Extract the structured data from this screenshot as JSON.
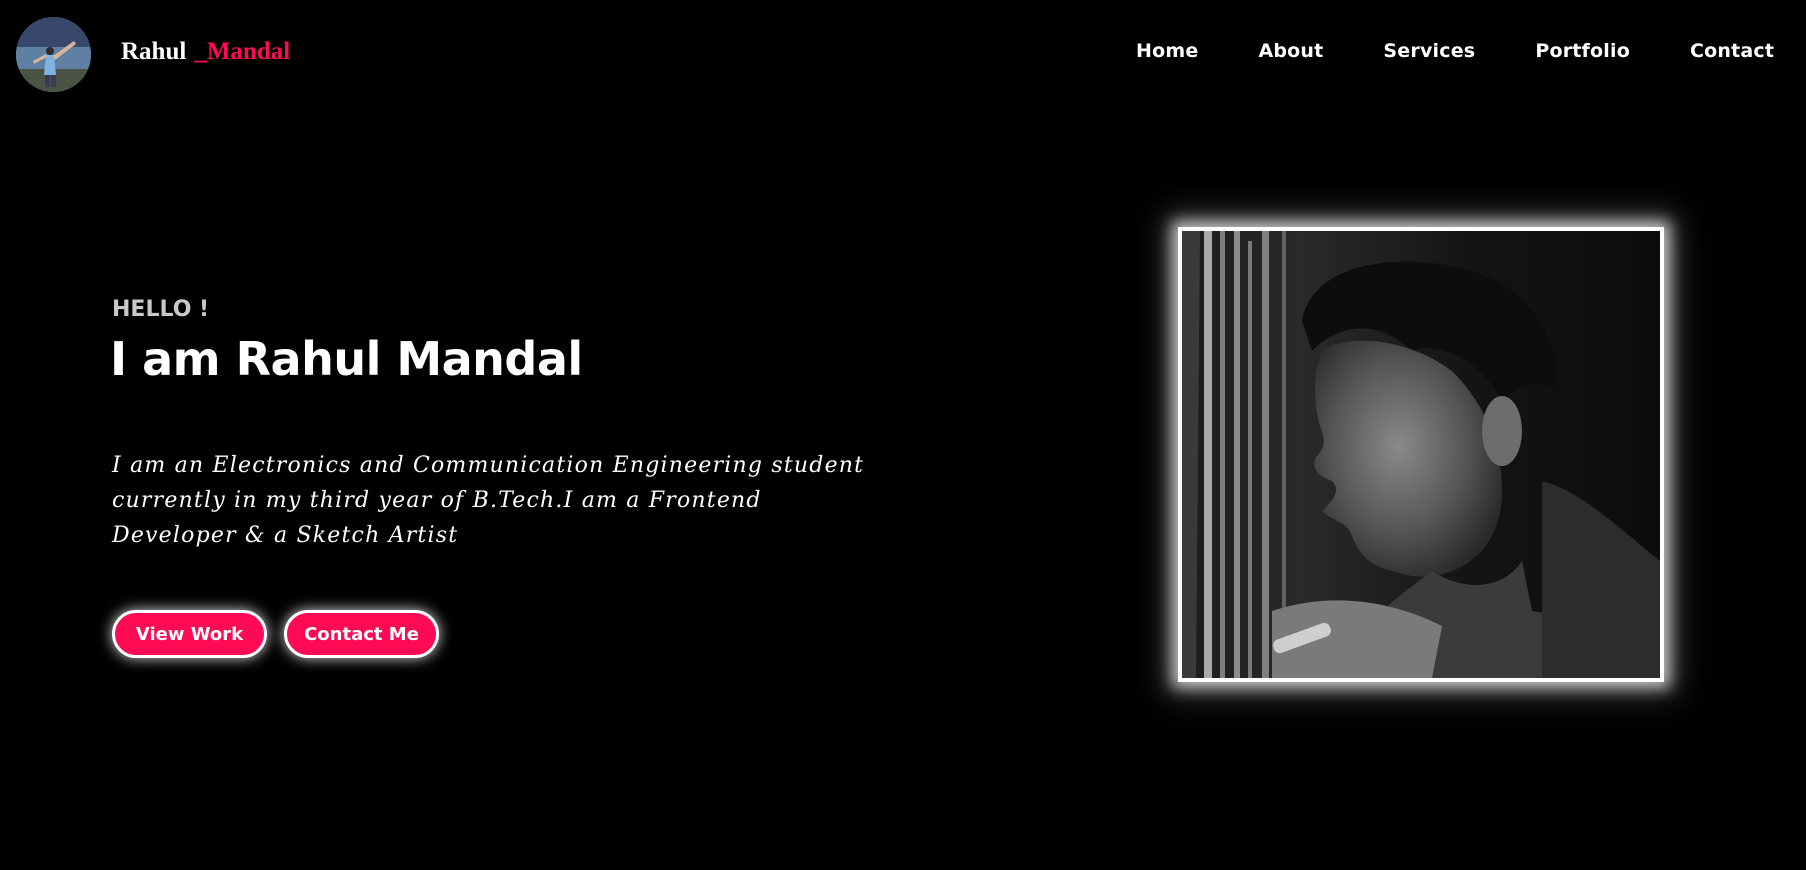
{
  "brand": {
    "first_name": "Rahul",
    "last_name": "_Mandal",
    "accent_color": "#ff0a54"
  },
  "avatar": {
    "icon": "profile-avatar"
  },
  "nav": {
    "items": [
      "Home",
      "About",
      "Services",
      "Portfolio",
      "Contact"
    ]
  },
  "hero": {
    "greeting": "HELLO !",
    "headline": "I am Rahul Mandal",
    "description": "I am an Electronics and Communication Engineering student currently in my third year of B.Tech.I am a Frontend Developer & a Sketch Artist",
    "buttons": {
      "view_work": "View Work",
      "contact_me": "Contact Me"
    }
  },
  "portrait": {
    "icon": "portrait-photo",
    "style": "black-and-white"
  },
  "colors": {
    "background": "#000000",
    "text": "#ffffff",
    "accent": "#ff0a54",
    "greeting": "#c9c9c9"
  }
}
